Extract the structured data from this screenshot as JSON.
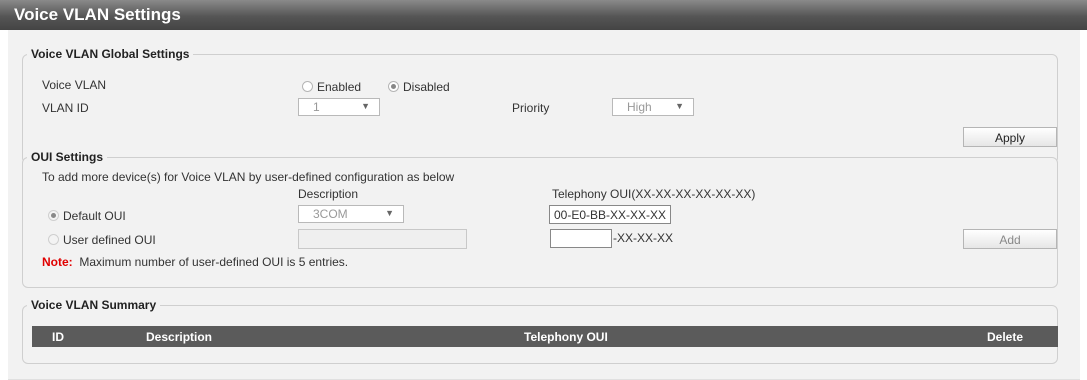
{
  "page_title": "Voice VLAN Settings",
  "global": {
    "legend": "Voice VLAN Global Settings",
    "voice_vlan_label": "Voice VLAN",
    "enabled_label": "Enabled",
    "disabled_label": "Disabled",
    "selected_mode": "Disabled",
    "vlan_id_label": "VLAN ID",
    "vlan_id_value": "1",
    "priority_label": "Priority",
    "priority_value": "High",
    "apply_label": "Apply"
  },
  "oui": {
    "legend": "OUI Settings",
    "intro": "To add more device(s) for Voice VLAN by user-defined configuration as below",
    "description_header": "Description",
    "telephony_header": "Telephony OUI(XX-XX-XX-XX-XX-XX)",
    "default_oui_label": "Default OUI",
    "default_description": "3COM",
    "default_telephony_oui": "00-E0-BB-XX-XX-XX",
    "user_defined_label": "User defined OUI",
    "user_description_value": "",
    "user_oui_value": "",
    "user_oui_suffix": "-XX-XX-XX",
    "add_label": "Add",
    "note_label": "Note:",
    "note_text": "Maximum number of user-defined OUI is 5 entries."
  },
  "summary": {
    "legend": "Voice VLAN Summary",
    "columns": {
      "id": "ID",
      "description": "Description",
      "telephony_oui": "Telephony OUI",
      "delete": "Delete"
    },
    "rows": []
  },
  "colors": {
    "title_bar": "#555555",
    "table_header": "#5b5b5b",
    "note": "#e00000",
    "panel": "#f2f2f2"
  }
}
